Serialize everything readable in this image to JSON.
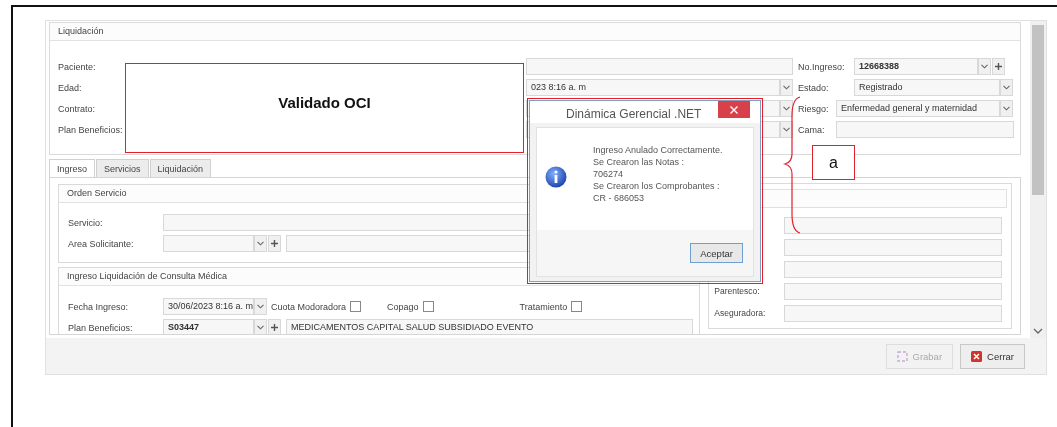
{
  "header_group": {
    "title": "Liquidación",
    "left_rows": [
      {
        "label": "Paciente:",
        "kind": "text"
      },
      {
        "label": "Edad:",
        "kind": "select",
        "value": "023 8:16 a. m"
      },
      {
        "label": "Contrato:",
        "kind": "select"
      },
      {
        "label": "Plan Beneficios:",
        "kind": "select"
      }
    ],
    "right_rows": [
      {
        "label": "No.Ingreso:",
        "kind": "lookup",
        "value": "12668388"
      },
      {
        "label": "Estado:",
        "kind": "select",
        "value": "Registrado"
      },
      {
        "label": "Riesgo:",
        "kind": "select",
        "value": "Enfermedad general y maternidad"
      },
      {
        "label": "Cama:",
        "kind": "text"
      }
    ]
  },
  "tabs": [
    {
      "label": "Ingreso",
      "selected": true
    },
    {
      "label": "Servicios",
      "selected": false
    },
    {
      "label": "Liquidación",
      "selected": false
    }
  ],
  "orden_servicio": {
    "title": "Orden Servicio",
    "rows": [
      {
        "label": "Servicio:",
        "kind": "text"
      },
      {
        "label": "Area Solicitante:",
        "kind": "lookup"
      }
    ]
  },
  "consulta": {
    "title": "Ingreso Liquidación de Consulta Médica",
    "fecha": {
      "label": "Fecha Ingreso:",
      "value": "30/06/2023 8:16 a. m"
    },
    "checks": [
      {
        "label": "Cuota Modoradora",
        "checked": false
      },
      {
        "label": "Copago",
        "checked": false
      },
      {
        "label": "Tratamiento",
        "checked": false
      }
    ],
    "plan": {
      "label": "Plan Beneficios:",
      "code": "S03447",
      "name": "MEDICAMENTOS CAPITAL SALUD SUBSIDIADO EVENTO"
    }
  },
  "right_group": {
    "rows": [
      {
        "kind": "text"
      },
      {
        "kind": "text"
      },
      {
        "kind": "text"
      },
      {
        "kind": "text",
        "label": "Parentesco:"
      },
      {
        "kind": "text",
        "label": "Aseguradora:"
      }
    ]
  },
  "buttons": [
    {
      "label": "Grabar",
      "kind": "save",
      "disabled": true
    },
    {
      "label": "Cerrar",
      "kind": "close",
      "disabled": false
    }
  ],
  "dialog": {
    "title": "Dinámica Gerencial .NET",
    "lines": [
      "Ingreso Anulado Correctamente.",
      "Se Crearon las Notas :",
      "706274",
      "Se Crearon los Comprobantes :",
      "CR - 686053"
    ],
    "button": "Aceptar"
  },
  "annotations": {
    "stamp": "Validado OCI",
    "callout": "a"
  }
}
